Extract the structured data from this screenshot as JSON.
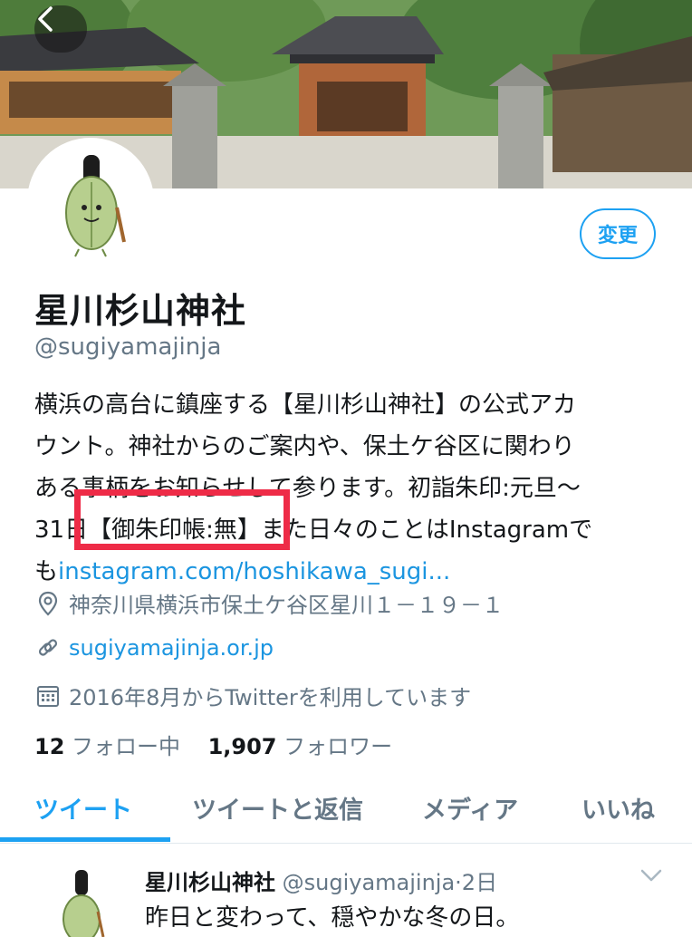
{
  "header": {
    "back_icon": "chevron-left-icon"
  },
  "profile": {
    "edit_label": "変更",
    "name": "星川杉山神社",
    "handle": "@sugiyamajinja",
    "bio_lines": [
      "横浜の高台に鎮座する【星川杉山神社】の公式アカ",
      "ウント。神社からのご案内や、保土ケ谷区に関わり",
      "ある事柄をお知らせして参ります。初詣朱印:元旦～",
      "31日【御朱印帳:無】また日々のことはInstagramで"
    ],
    "bio_last_prefix": "も",
    "bio_link": "instagram.com/hoshikawa_sugi...",
    "location": "神奈川県横浜市保土ケ谷区星川１－１９－１",
    "website": "sugiyamajinja.or.jp",
    "joined": "2016年8月からTwitterを利用しています",
    "following_count": "12",
    "following_label": "フォロー中",
    "followers_count": "1,907",
    "followers_label": "フォロワー"
  },
  "tabs": [
    {
      "label": "ツイート",
      "active": true
    },
    {
      "label": "ツイートと返信",
      "active": false
    },
    {
      "label": "メディア",
      "active": false
    },
    {
      "label": "いいね",
      "active": false
    }
  ],
  "tweet": {
    "name": "星川杉山神社",
    "handle_time": "@sugiyamajinja·2日",
    "text": "昨日と変わって、穏やかな冬の日。"
  },
  "colors": {
    "accent": "#1da1f2",
    "link": "#1b95e0",
    "muted": "#657786",
    "highlight": "#ee2b47"
  }
}
